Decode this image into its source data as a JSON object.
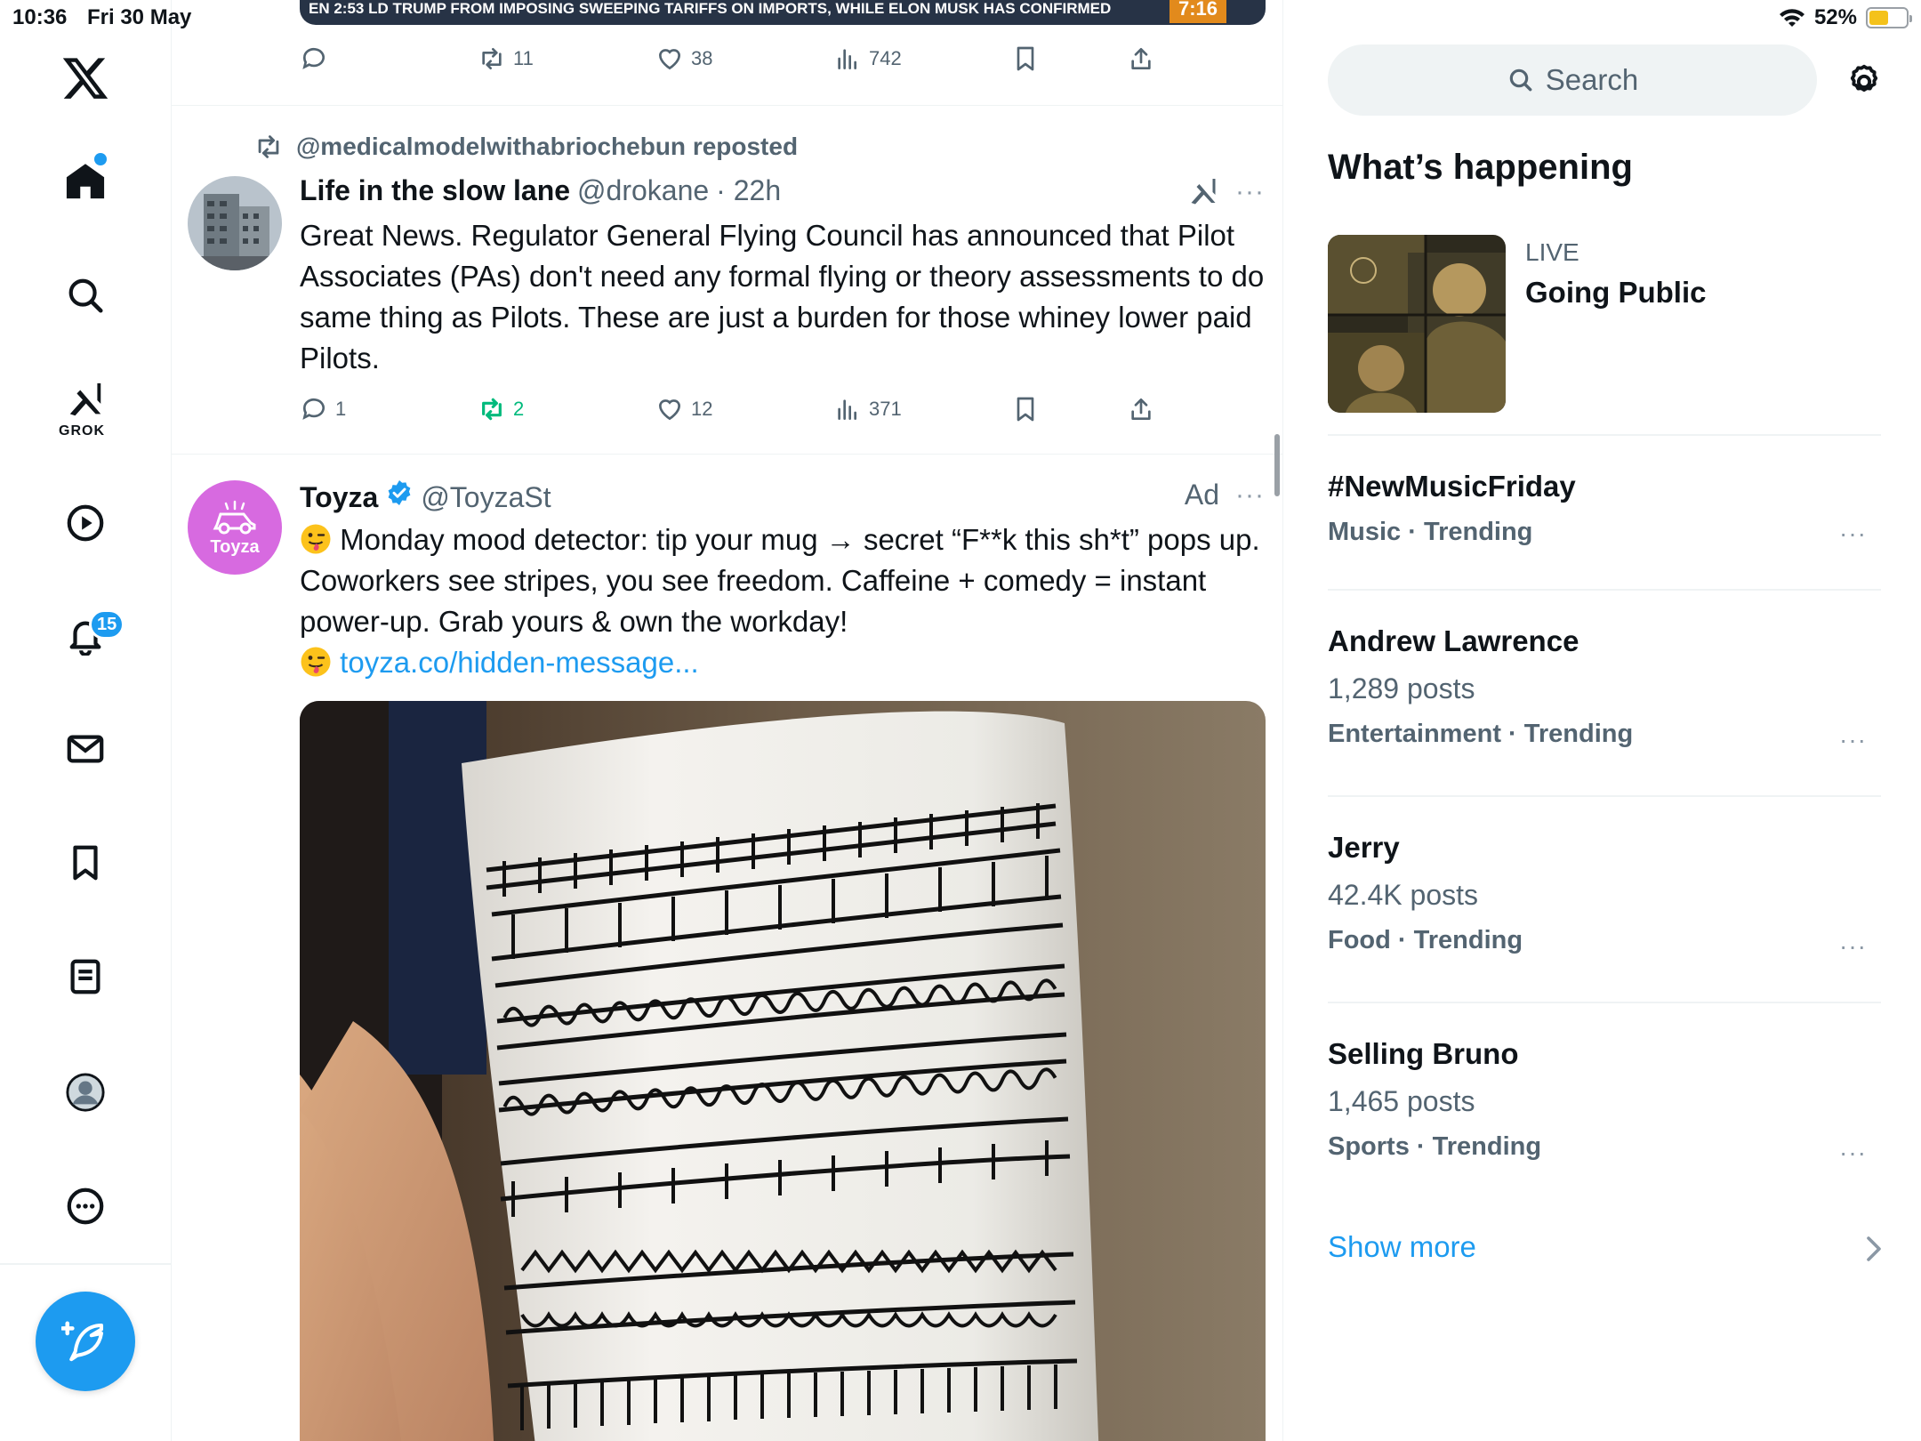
{
  "status_bar": {
    "time": "10:36",
    "date": "Fri 30 May",
    "battery": "52%",
    "battery_level": 0.52
  },
  "nav": {
    "items": [
      "home-icon",
      "search-icon",
      "grok-icon",
      "video-icon",
      "notifications-icon",
      "messages-icon",
      "bookmarks-icon",
      "lists-icon",
      "profile-icon",
      "more-icon"
    ],
    "grok_label": "GROK",
    "notifications_badge": "15"
  },
  "top_tweet": {
    "video_caption": "EN  2:53  LD TRUMP FROM IMPOSING SWEEPING TARIFFS ON IMPORTS, WHILE ELON MUSK HAS CONFIRMED",
    "video_time": "7:16",
    "stats": {
      "replies": "",
      "reposts": "11",
      "likes": "38",
      "views": "742"
    }
  },
  "repost_tweet": {
    "repost_label": "@medicalmodelwithabriochebun reposted",
    "name": "Life in the slow lane",
    "handle": "@drokane",
    "time": "· 22h",
    "body": "Great News. Regulator General Flying Council has announced that Pilot Associates (PAs) don't need any formal flying or theory assessments to do same thing as Pilots. These are just a burden for those whiney lower paid Pilots.",
    "stats": {
      "replies": "1",
      "reposts": "2",
      "likes": "12",
      "views": "371"
    }
  },
  "ad_tweet": {
    "name": "Toyza",
    "handle": "@ToyzaSt",
    "ad_label": "Ad",
    "avatar_text": "Toyza",
    "body": "Monday mood detector: tip your mug → secret “F**k this sh*t” pops up. Coworkers see stripes, you see freedom. Caffeine + comedy = instant power-up. Grab yours & own the workday!",
    "link": "toyza.co/hidden-message..."
  },
  "sidebar": {
    "search_placeholder": "Search",
    "title": "What’s happening",
    "live": {
      "tag": "LIVE",
      "title": "Going Public"
    },
    "trends": [
      {
        "title": "#NewMusicFriday",
        "posts": "",
        "meta": "Music · Trending"
      },
      {
        "title": "Andrew Lawrence",
        "posts": "1,289 posts",
        "meta": "Entertainment · Trending"
      },
      {
        "title": "Jerry",
        "posts": "42.4K posts",
        "meta": "Food · Trending"
      },
      {
        "title": "Selling Bruno",
        "posts": "1,465 posts",
        "meta": "Sports · Trending"
      }
    ],
    "show_more": "Show more",
    "more_dots": "···"
  }
}
